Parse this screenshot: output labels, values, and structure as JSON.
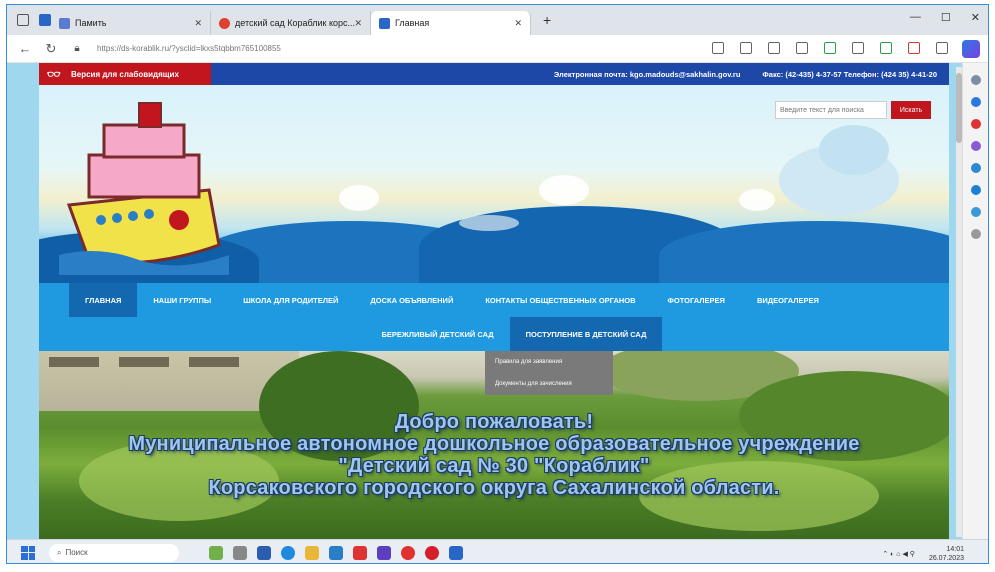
{
  "browser": {
    "tabs": [
      {
        "label": "Памить"
      },
      {
        "label": "детский сад Кораблик корс..."
      },
      {
        "label": "Главная"
      }
    ],
    "url": "https://ds-korablik.ru/?ysclid=lkxs5tqbbm765100855"
  },
  "site": {
    "vi_button": "Версия для слабовидящих",
    "email": "Электронная почта: kgo.madouds@sakhalin.gov.ru",
    "phone": "Факс: (42-435) 4-37-57 Телефон: (424 35) 4-41-20",
    "search": {
      "placeholder": "Введите текст для поиска",
      "button": "Искать"
    },
    "nav": {
      "row1": [
        "Главная",
        "Наши группы",
        "Школа для родителей",
        "Доска объявлений",
        "Контакты общественных органов",
        "Фотогалерея",
        "Видеогалерея"
      ],
      "row2": [
        "Бережливый детский сад",
        "Поступление в детский сад"
      ]
    },
    "dropdown": [
      "Правила для заявления",
      "Документы для зачисления"
    ],
    "hero": {
      "line1": "Добро пожаловать!",
      "line2": "Муниципальное автономное дошкольное образовательное учреждение",
      "line3": "\"Детский сад № 30 \"Кораблик\"",
      "line4": "Корсаковского городского округа Сахалинской области."
    }
  },
  "taskbar": {
    "search_placeholder": "Поиск",
    "time": "14:01",
    "date": "26.07.2023"
  }
}
